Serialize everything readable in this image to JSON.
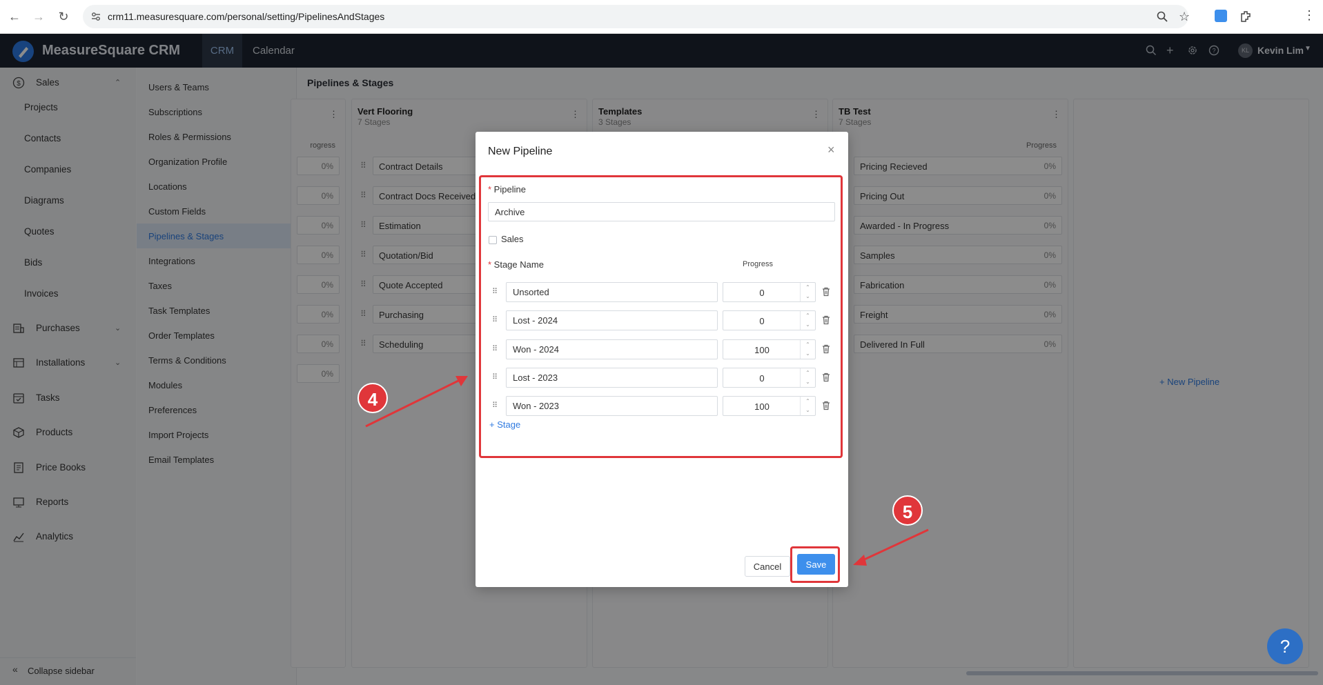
{
  "browser": {
    "url": "crm11.measuresquare.com/personal/setting/PipelinesAndStages"
  },
  "header": {
    "brand": "MeasureSquare CRM",
    "tabs": [
      "CRM",
      "Calendar"
    ],
    "user_initials": "KL",
    "user_name": "Kevin Lim"
  },
  "sidebar": {
    "items": [
      {
        "label": "Sales",
        "icon": "dollar-icon",
        "expandable": true
      },
      {
        "label": "Projects"
      },
      {
        "label": "Contacts"
      },
      {
        "label": "Companies"
      },
      {
        "label": "Diagrams"
      },
      {
        "label": "Quotes"
      },
      {
        "label": "Bids"
      },
      {
        "label": "Invoices"
      },
      {
        "label": "Purchases",
        "icon": "purchases-icon",
        "expandable": true
      },
      {
        "label": "Installations",
        "icon": "installations-icon",
        "expandable": true
      },
      {
        "label": "Tasks",
        "icon": "tasks-icon"
      },
      {
        "label": "Products",
        "icon": "products-icon"
      },
      {
        "label": "Price Books",
        "icon": "price-books-icon"
      },
      {
        "label": "Reports",
        "icon": "reports-icon"
      },
      {
        "label": "Analytics",
        "icon": "analytics-icon"
      }
    ],
    "collapse_label": "Collapse sidebar"
  },
  "settings_nav": {
    "items": [
      "Users & Teams",
      "Subscriptions",
      "Roles & Permissions",
      "Organization Profile",
      "Locations",
      "Custom Fields",
      "Pipelines & Stages",
      "Integrations",
      "Taxes",
      "Task Templates",
      "Order Templates",
      "Terms & Conditions",
      "Modules",
      "Preferences",
      "Import Projects",
      "Email Templates"
    ],
    "active": "Pipelines & Stages"
  },
  "content": {
    "title": "Pipelines & Stages",
    "partial_column": {
      "progress_header": "rogress",
      "pcts": [
        "0%",
        "0%",
        "0%",
        "0%",
        "0%",
        "0%",
        "0%",
        "0%"
      ]
    },
    "pipelines": [
      {
        "name": "Vert Flooring",
        "sub": "7 Stages",
        "stages": [
          "Contract Details",
          "Contract Docs Received",
          "Estimation",
          "Quotation/Bid",
          "Quote Accepted",
          "Purchasing",
          "Scheduling"
        ]
      },
      {
        "name": "Templates",
        "sub": "3 Stages",
        "stages": []
      },
      {
        "name": "TB Test",
        "sub": "7 Stages",
        "progress_header": "Progress",
        "stages": [
          "Pricing Recieved",
          "Pricing Out",
          "Awarded - In Progress",
          "Samples",
          "Fabrication",
          "Freight",
          "Delivered In Full"
        ],
        "pct": "0%"
      }
    ],
    "new_pipeline_label": "New Pipeline"
  },
  "modal": {
    "title": "New Pipeline",
    "pipeline_label": "Pipeline",
    "pipeline_value": "Archive",
    "sales_label": "Sales",
    "stage_name_label": "Stage Name",
    "progress_label": "Progress",
    "stages": [
      {
        "name": "Unsorted",
        "progress": "0"
      },
      {
        "name": "Lost - 2024",
        "progress": "0"
      },
      {
        "name": "Won - 2024",
        "progress": "100"
      },
      {
        "name": "Lost - 2023",
        "progress": "0"
      },
      {
        "name": "Won - 2023",
        "progress": "100"
      }
    ],
    "add_stage_label": "Stage",
    "cancel_label": "Cancel",
    "save_label": "Save"
  },
  "annotations": {
    "step4": "4",
    "step5": "5",
    "color": "#e0363a"
  }
}
